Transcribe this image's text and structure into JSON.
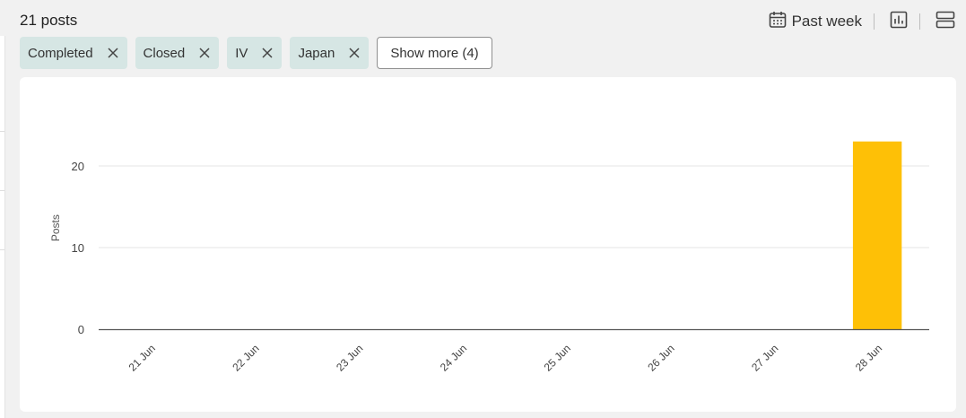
{
  "header": {
    "post_count": "21 posts",
    "date_range": "Past week",
    "icons": [
      "calendar-icon",
      "bar-chart-icon",
      "layout-rows-icon"
    ]
  },
  "filters": [
    {
      "label": "Completed"
    },
    {
      "label": "Closed"
    },
    {
      "label": "IV"
    },
    {
      "label": "Japan"
    }
  ],
  "show_more_label": "Show more (4)",
  "colors": {
    "bar": "#fec006",
    "chip_bg": "#d6e6e4",
    "page_bg": "#f1f1f1"
  },
  "chart_data": {
    "type": "bar",
    "categories": [
      "21 Jun",
      "22 Jun",
      "23 Jun",
      "24 Jun",
      "25 Jun",
      "26 Jun",
      "27 Jun",
      "28 Jun"
    ],
    "values": [
      0,
      0,
      0,
      0,
      0,
      0,
      0,
      23
    ],
    "ylabel": "Posts",
    "xlabel": "",
    "ylim": [
      0,
      27
    ],
    "yticks": [
      0,
      10,
      20
    ],
    "grid": true,
    "legend": "none"
  }
}
